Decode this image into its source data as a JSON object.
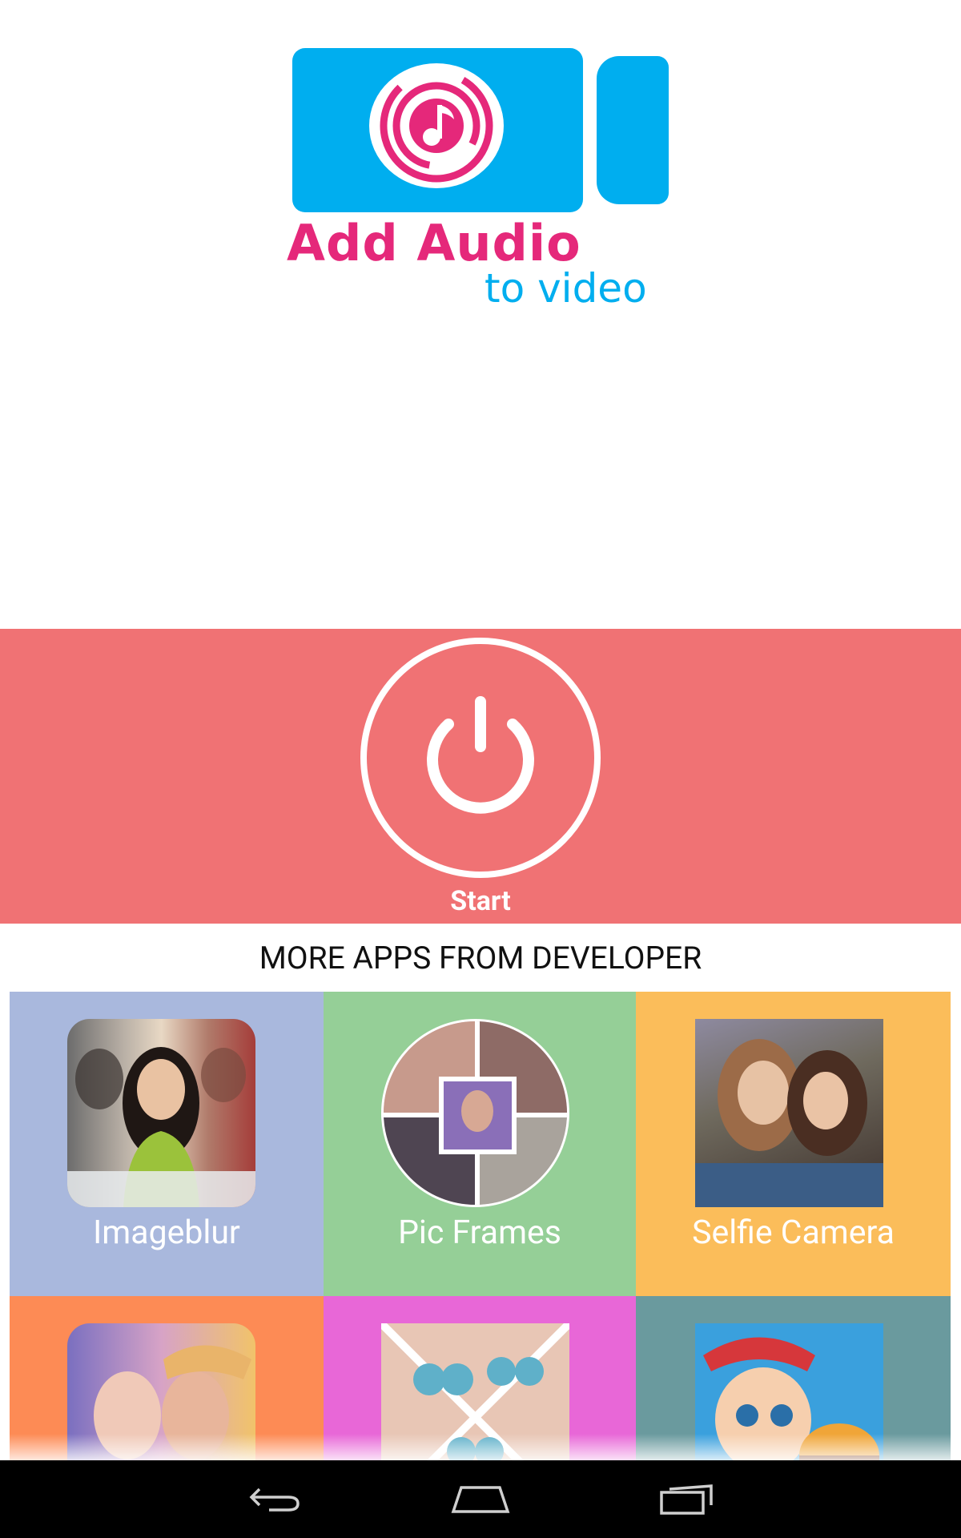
{
  "logo": {
    "line1": "Add Audio",
    "line2": "to video"
  },
  "start_button": {
    "label": "Start",
    "icon": "power-icon"
  },
  "more_apps": {
    "heading": "MORE APPS FROM DEVELOPER",
    "apps": [
      {
        "name": "Imageblur",
        "color": "#a9b8dd"
      },
      {
        "name": "Pic Frames",
        "color": "#95cf97"
      },
      {
        "name": "Selfie Camera",
        "color": "#fbbd5a"
      },
      {
        "name": "",
        "color": "#fd8b55"
      },
      {
        "name": "",
        "color": "#e867d7"
      },
      {
        "name": "",
        "color": "#6a9a9e"
      }
    ]
  },
  "navbar": {
    "back_icon": "back-icon",
    "home_icon": "home-icon",
    "recents_icon": "recents-icon"
  },
  "colors": {
    "brand_pink": "#e5287a",
    "brand_blue": "#00aeef",
    "start_panel": "#f07274",
    "navbar": "#000000"
  }
}
